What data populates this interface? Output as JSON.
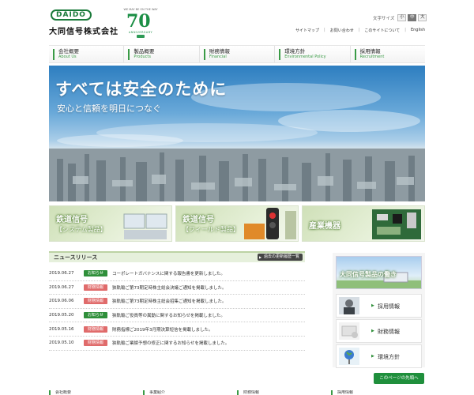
{
  "header": {
    "logo_badge": "DAIDO",
    "logo_text": "大同信号株式会社",
    "anniversary": {
      "tagline": "WE MAY BE ON THE WAY",
      "number": "70",
      "label": "ANNIVERSARY"
    },
    "font_size": {
      "label": "文字サイズ",
      "options": [
        "小",
        "中",
        "大"
      ],
      "selected": "中"
    },
    "links": [
      "サイトマップ",
      "お問い合わせ",
      "このサイトについて",
      "English"
    ]
  },
  "nav": {
    "items": [
      {
        "jp": "会社概要",
        "en": "About Us"
      },
      {
        "jp": "製品概要",
        "en": "Products"
      },
      {
        "jp": "財務情報",
        "en": "Financial"
      },
      {
        "jp": "環境方針",
        "en": "Environmental Policy"
      },
      {
        "jp": "採用情報",
        "en": "Recruitment"
      }
    ]
  },
  "hero": {
    "headline": "すべては安全のために",
    "subline": "安心と信頼を明日につなぐ"
  },
  "categories": [
    {
      "line1": "鉄道信号",
      "line2": "【システム製品】"
    },
    {
      "line1": "鉄道信号",
      "line2": "【フィールド製品】"
    },
    {
      "line1": "産業機器",
      "line2": ""
    }
  ],
  "news": {
    "heading": "ニュースリリース",
    "archive_label": "過去の更新履歴一覧",
    "items": [
      {
        "date": "2019.06.27",
        "category": "お知らせ",
        "kind": "notice",
        "title": "コーポレートガバナンスに関する報告書を更新しました。"
      },
      {
        "date": "2019.06.27",
        "category": "財務情報",
        "kind": "finance",
        "title": "狭軌輸ご第73期定時株主総会決議ご通知を掲載しました。"
      },
      {
        "date": "2019.06.06",
        "category": "財務情報",
        "kind": "finance",
        "title": "狭軌輸ご第73期定時株主総会招集ご通知を掲載しました。"
      },
      {
        "date": "2019.05.20",
        "category": "お知らせ",
        "kind": "notice",
        "title": "狭軌輸ご役員等の異動に関するお知らせを掲載しました。"
      },
      {
        "date": "2019.05.16",
        "category": "財務情報",
        "kind": "finance",
        "title": "財務指標ご2019年3月期決算短信を掲載しました。"
      },
      {
        "date": "2019.05.10",
        "category": "財務情報",
        "kind": "finance",
        "title": "狭軌輸ご業績予想の修正に関するお知らせを掲載しました。"
      }
    ]
  },
  "side": {
    "banner": "大同信号製品の働き",
    "links": [
      "採用情報",
      "財務情報",
      "環境方針"
    ]
  },
  "pagetop": "このページの先頭へ",
  "footer": [
    "会社概要",
    "事業紹介",
    "財務情報",
    "採用情報"
  ]
}
